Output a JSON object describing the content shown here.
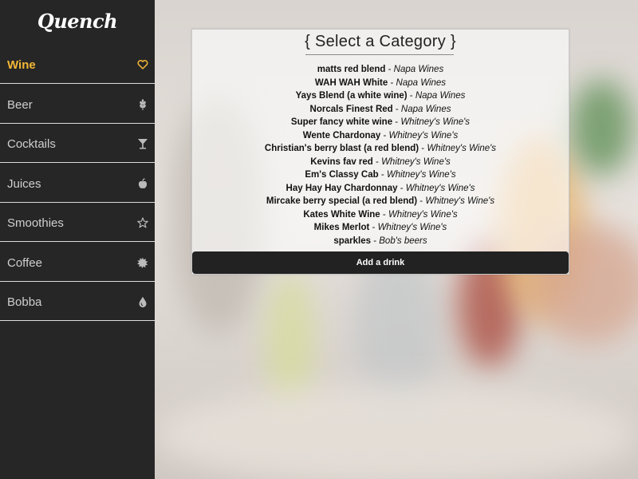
{
  "app": {
    "logo": "Quench"
  },
  "sidebar": {
    "items": [
      {
        "label": "Wine",
        "icon": "heart-icon",
        "active": true
      },
      {
        "label": "Beer",
        "icon": "wheat-icon"
      },
      {
        "label": "Cocktails",
        "icon": "cocktail-icon"
      },
      {
        "label": "Juices",
        "icon": "apple-icon"
      },
      {
        "label": "Smoothies",
        "icon": "star-icon"
      },
      {
        "label": "Coffee",
        "icon": "coffee-bean-icon"
      },
      {
        "label": "Bobba",
        "icon": "drop-icon"
      }
    ]
  },
  "panel": {
    "title": "{ Select a Category }",
    "drinks": [
      {
        "name": "matts red blend",
        "sep": " - ",
        "source": "Napa Wines"
      },
      {
        "name": "WAH WAH White",
        "sep": " - ",
        "source": "Napa Wines"
      },
      {
        "name": "Yays Blend (a white wine)",
        "sep": " - ",
        "source": "Napa Wines"
      },
      {
        "name": "Norcals Finest Red",
        "sep": " - ",
        "source": "Napa Wines"
      },
      {
        "name": "Super fancy white wine",
        "sep": " - ",
        "source": "Whitney's Wine's"
      },
      {
        "name": "Wente Chardonay",
        "sep": " - ",
        "source": "Whitney's Wine's"
      },
      {
        "name": "Christian's berry blast (a red blend)",
        "sep": " - ",
        "source": "Whitney's Wine's"
      },
      {
        "name": "Kevins fav red",
        "sep": " - ",
        "source": "Whitney's Wine's"
      },
      {
        "name": "Em's Classy Cab",
        "sep": " - ",
        "source": "Whitney's Wine's"
      },
      {
        "name": "Hay Hay Hay Chardonnay",
        "sep": " - ",
        "source": "Whitney's Wine's"
      },
      {
        "name": "Mircake berry special (a red blend)",
        "sep": " - ",
        "source": "Whitney's Wine's"
      },
      {
        "name": "Kates White Wine",
        "sep": " - ",
        "source": "Whitney's Wine's"
      },
      {
        "name": "Mikes Merlot",
        "sep": " - ",
        "source": "Whitney's Wine's"
      },
      {
        "name": "sparkles",
        "sep": " - ",
        "source": "Bob's beers"
      }
    ],
    "add_button": "Add a drink"
  },
  "colors": {
    "active": "#f3b736",
    "sidebar_bg": "#262626",
    "button_bg": "#222222"
  }
}
